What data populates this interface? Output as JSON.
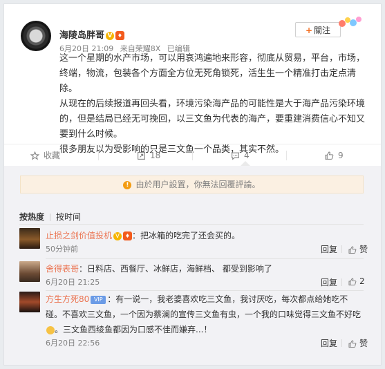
{
  "post": {
    "username": "海陵岛胖哥",
    "time": "6月20日 21:09",
    "source": "来自荣耀8X",
    "edited": "已编辑",
    "follow_label": "關注",
    "paragraphs": [
      "这一个星期的水产市场，可以用哀鸿遍地来形容，彻底从贸易，平台，市场，终端，物流，包装各个方面全方位无死角锁死，活生生一个精准打击定点清除。",
      "从现在的后续报道再回头看，环境污染海产品的可能性是大于海产品污染环境的，但是结局已经无可挽回，以三文鱼为代表的海产，要重建消费信心不知又要到什么时候。",
      "很多朋友以为受影响的只是三文鱼一个品类，其实不然。"
    ]
  },
  "actions": {
    "favorite": "收藏",
    "repost": "18",
    "comment": "4",
    "like": "9"
  },
  "notice": "由於用户設置，你無法回覆評論。",
  "sort": {
    "hot": "按热度",
    "time": "按时间"
  },
  "comments": [
    {
      "name": "止损之剑价值投机",
      "text": "：把冰箱的吃完了还会买的。",
      "time": "50分钟前",
      "reply": "回复",
      "like": "赞"
    },
    {
      "name": "舍得表哥",
      "text": "：日料店、西餐厅、冰鲜店，海鲜档、 都受到影响了",
      "time": "6月20日 21:25",
      "reply": "回复",
      "like": "2"
    },
    {
      "name": "方生方死80",
      "text": "：有一说一，我老婆喜欢吃三文鱼，我讨厌吃，每次都点给她吃不碰。不喜欢三文鱼，一个因为蔡澜的宣传三文鱼有虫，一个我的口味觉得三文鱼不好吃",
      "text_end": "。三文鱼西绫鱼都因为口感不佳而嫌弃...！",
      "time": "6月20日 22:56",
      "reply": "回复",
      "like": "赞"
    }
  ],
  "colors": {
    "accent": "#eb7350",
    "brand": "#f36f21",
    "notice_bg": "#fbf0e2"
  }
}
